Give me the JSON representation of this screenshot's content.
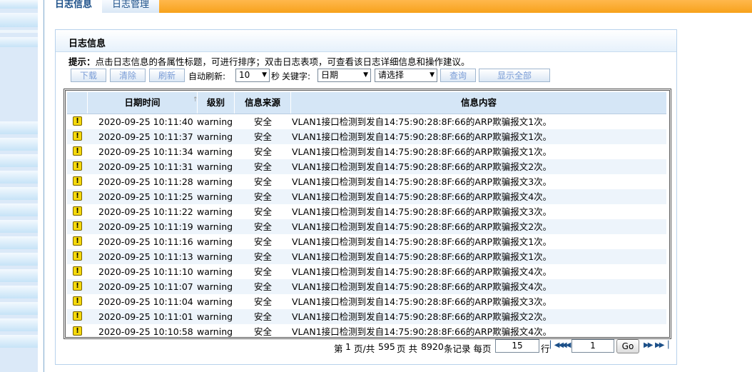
{
  "tabs": [
    {
      "label": "日志信息",
      "active": true
    },
    {
      "label": "日志管理",
      "active": false
    }
  ],
  "panel": {
    "title": "日志信息",
    "hint_label": "提示：",
    "hint_text": "点击日志信息的各属性标题，可进行排序；双击日志表项，可查看该日志详细信息和操作建议。"
  },
  "toolbar": {
    "download_label": "下载",
    "clear_label": "清除",
    "refresh_label": "刷新",
    "auto_refresh_label": "自动刷新:",
    "auto_refresh_value": "10",
    "seconds_label": "秒",
    "keyword_label": "关键字:",
    "keyword_field_value": "日期",
    "keyword_choice_value": "请选择",
    "query_label": "查询",
    "show_all_label": "显示全部"
  },
  "table": {
    "columns": [
      "日期时间",
      "级别",
      "信息来源",
      "信息内容"
    ],
    "rows": [
      {
        "time": "2020-09-25 10:11:40",
        "level": "warning",
        "source": "安全",
        "content": "VLAN1接口检测到发自14:75:90:28:8F:66的ARP欺骗报文1次。"
      },
      {
        "time": "2020-09-25 10:11:37",
        "level": "warning",
        "source": "安全",
        "content": "VLAN1接口检测到发自14:75:90:28:8F:66的ARP欺骗报文1次。"
      },
      {
        "time": "2020-09-25 10:11:34",
        "level": "warning",
        "source": "安全",
        "content": "VLAN1接口检测到发自14:75:90:28:8F:66的ARP欺骗报文1次。"
      },
      {
        "time": "2020-09-25 10:11:31",
        "level": "warning",
        "source": "安全",
        "content": "VLAN1接口检测到发自14:75:90:28:8F:66的ARP欺骗报文2次。"
      },
      {
        "time": "2020-09-25 10:11:28",
        "level": "warning",
        "source": "安全",
        "content": "VLAN1接口检测到发自14:75:90:28:8F:66的ARP欺骗报文3次。"
      },
      {
        "time": "2020-09-25 10:11:25",
        "level": "warning",
        "source": "安全",
        "content": "VLAN1接口检测到发自14:75:90:28:8F:66的ARP欺骗报文4次。"
      },
      {
        "time": "2020-09-25 10:11:22",
        "level": "warning",
        "source": "安全",
        "content": "VLAN1接口检测到发自14:75:90:28:8F:66的ARP欺骗报文3次。"
      },
      {
        "time": "2020-09-25 10:11:19",
        "level": "warning",
        "source": "安全",
        "content": "VLAN1接口检测到发自14:75:90:28:8F:66的ARP欺骗报文2次。"
      },
      {
        "time": "2020-09-25 10:11:16",
        "level": "warning",
        "source": "安全",
        "content": "VLAN1接口检测到发自14:75:90:28:8F:66的ARP欺骗报文1次。"
      },
      {
        "time": "2020-09-25 10:11:13",
        "level": "warning",
        "source": "安全",
        "content": "VLAN1接口检测到发自14:75:90:28:8F:66的ARP欺骗报文1次。"
      },
      {
        "time": "2020-09-25 10:11:10",
        "level": "warning",
        "source": "安全",
        "content": "VLAN1接口检测到发自14:75:90:28:8F:66的ARP欺骗报文4次。"
      },
      {
        "time": "2020-09-25 10:11:07",
        "level": "warning",
        "source": "安全",
        "content": "VLAN1接口检测到发自14:75:90:28:8F:66的ARP欺骗报文4次。"
      },
      {
        "time": "2020-09-25 10:11:04",
        "level": "warning",
        "source": "安全",
        "content": "VLAN1接口检测到发自14:75:90:28:8F:66的ARP欺骗报文3次。"
      },
      {
        "time": "2020-09-25 10:11:01",
        "level": "warning",
        "source": "安全",
        "content": "VLAN1接口检测到发自14:75:90:28:8F:66的ARP欺骗报文2次。"
      },
      {
        "time": "2020-09-25 10:10:58",
        "level": "warning",
        "source": "安全",
        "content": "VLAN1接口检测到发自14:75:90:28:8F:66的ARP欺骗报文4次。"
      }
    ]
  },
  "pagination": {
    "page_prefix": "第",
    "current_page": "1",
    "page_mid": "页/共",
    "total_pages": "595",
    "page_suffix": "页 共",
    "total_records": "8920",
    "records_suffix": "条记录 每页",
    "per_page": "15",
    "rows_label": "行",
    "goto_page": "1",
    "go_label": "Go"
  },
  "icons": {
    "row_level_icon": "warning-icon",
    "sort_icon": "sort-arrow-icon",
    "first_page": "first-page-icon",
    "prev_page": "prev-page-icon",
    "next_page": "next-page-icon",
    "last_page": "last-page-icon"
  },
  "colors": {
    "tab_bar": "#f7a21b",
    "header_bg": "#d5e6f6",
    "alt_row": "#edf4fb",
    "warning_icon": "#f5d90a",
    "link_blue": "#1b4f88"
  }
}
